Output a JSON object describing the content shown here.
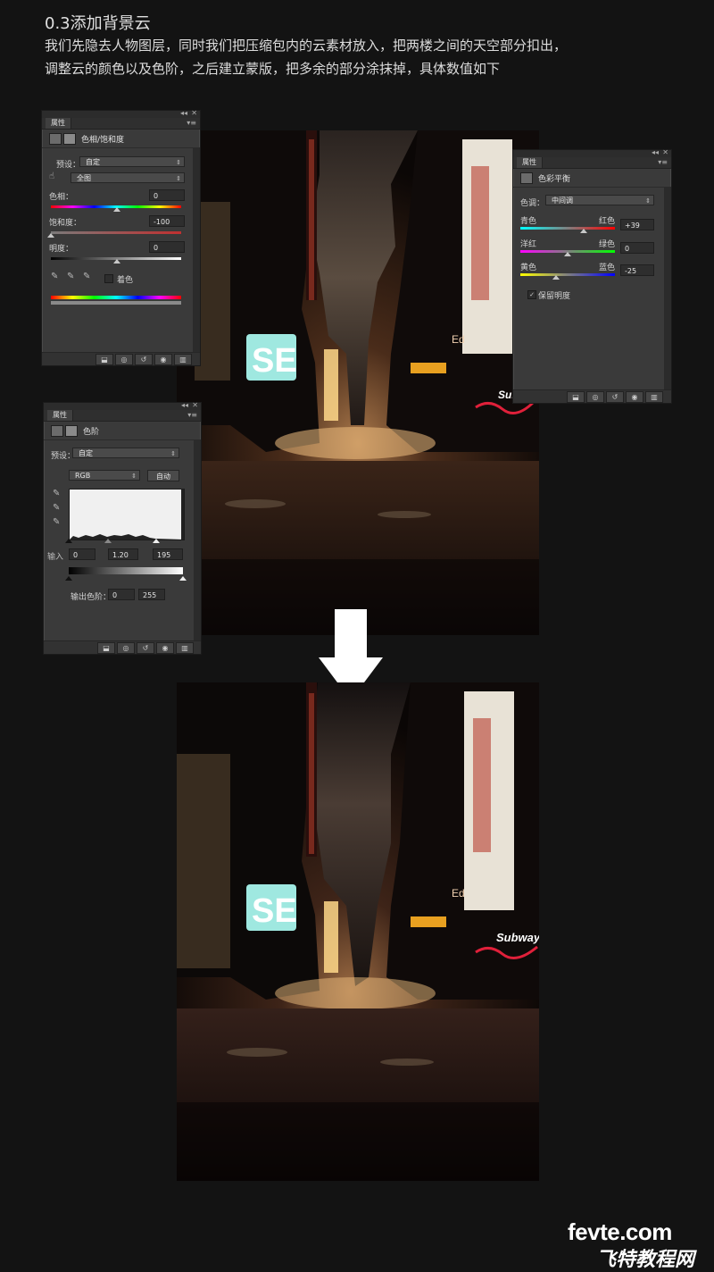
{
  "header": {
    "heading": "0.3添加背景云",
    "line1": "我们先隐去人物图层，同时我们把压缩包内的云素材放入，把两楼之间的天空部分扣出，",
    "line2": "调整云的颜色以及色阶，之后建立蒙版，把多余的部分涂抹掉，具体数值如下"
  },
  "panel_hue": {
    "tab": "属性",
    "title": "色相/饱和度",
    "preset_label": "预设：",
    "preset_value": "自定",
    "channel_value": "全图",
    "hue_label": "色相：",
    "hue_value": "0",
    "sat_label": "饱和度：",
    "sat_value": "-100",
    "light_label": "明度：",
    "light_value": "0",
    "colorize_label": "着色"
  },
  "panel_balance": {
    "tab": "属性",
    "title": "色彩平衡",
    "tone_label": "色调：",
    "tone_value": "中间调",
    "cyan": "青色",
    "red": "红色",
    "cr_value": "+39",
    "magenta": "洋红",
    "green": "绿色",
    "mg_value": "0",
    "yellow": "黄色",
    "blue": "蓝色",
    "yb_value": "-25",
    "preserve_label": "保留明度"
  },
  "panel_levels": {
    "tab": "属性",
    "title": "色阶",
    "preset_label": "预设：",
    "preset_value": "自定",
    "channel_value": "RGB",
    "auto_label": "自动",
    "input_black": "0",
    "input_gamma": "1.20",
    "input_white": "195",
    "output_label": "输出色阶：",
    "output_black": "0",
    "output_white": "255"
  },
  "scene_top": {
    "sign_se": "SE",
    "sign_subway": "Subway",
    "sign_ed": "Ed"
  },
  "scene_bottom": {
    "sign_se": "SE",
    "sign_subway": "Subway",
    "sign_ed": "Ed"
  },
  "watermark": {
    "line1": "fevte.com",
    "line2": "飞特教程网"
  },
  "colors": {
    "background": "#131313",
    "panel": "#3a3a3a",
    "arrow": "#ffffff",
    "sign_cyan": "#9fe8e0",
    "subway_red": "#e0203a"
  }
}
